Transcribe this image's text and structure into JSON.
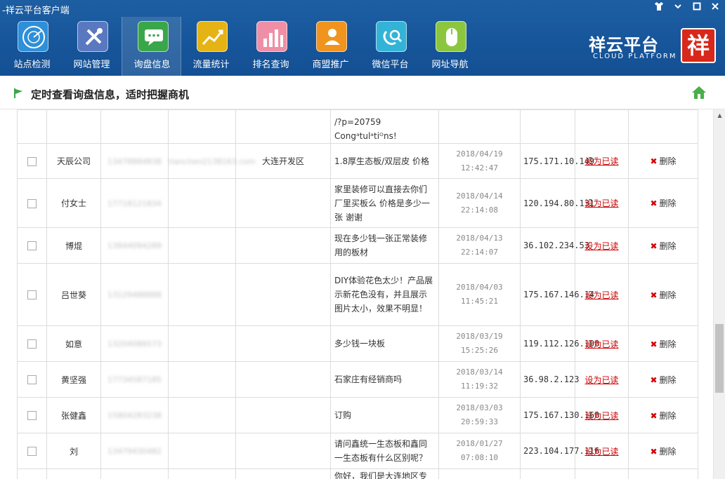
{
  "window": {
    "title": "-祥云平台客户端"
  },
  "nav": [
    {
      "label": "站点检测",
      "icon": "radar-icon",
      "color": "#2f8fd8"
    },
    {
      "label": "网站管理",
      "icon": "tools-icon",
      "color": "#5a78c0"
    },
    {
      "label": "询盘信息",
      "icon": "chat-icon",
      "color": "#3aa64a"
    },
    {
      "label": "流量统计",
      "icon": "trend-icon",
      "color": "#e6b314"
    },
    {
      "label": "排名查询",
      "icon": "bar-chart-icon",
      "color": "#ef8fa6"
    },
    {
      "label": "商盟推广",
      "icon": "people-icon",
      "color": "#f0941d"
    },
    {
      "label": "微信平台",
      "icon": "wechat-icon",
      "color": "#33b3d6"
    },
    {
      "label": "网址导航",
      "icon": "mouse-icon",
      "color": "#8cc63e"
    }
  ],
  "brand": {
    "cn": "祥云平台",
    "en": "CLOUD PLATFORM",
    "logo_char": "祥"
  },
  "subheader": {
    "title": "定时查看询盘信息，适时把握商机"
  },
  "table": {
    "mark_read_label": "设为已读",
    "delete_label": "删除",
    "rows": [
      {
        "name": "",
        "phone": "",
        "email": "",
        "region": "",
        "content": "/?p=20759 Congᵃtulᵃtiᴼns!",
        "time": "",
        "ip": "",
        "partial": true
      },
      {
        "name": "天辰公司",
        "phone": "13478884838",
        "email": "tianchen2138163.com",
        "region": "大连开发区",
        "content": "1.8厚生态板/双层皮 价格",
        "time": "2018/04/19 12:42:47",
        "ip": "175.171.10.149"
      },
      {
        "name": "付女士",
        "phone": "17718121834",
        "email": "",
        "region": "",
        "content": "家里装修可以直接去你们厂里买板么 价格是多少一张 谢谢",
        "time": "2018/04/14 22:14:08",
        "ip": "120.194.80.131"
      },
      {
        "name": "博焜",
        "phone": "13844094289",
        "email": "",
        "region": "",
        "content": "现在多少钱一张正常装修用的板材",
        "time": "2018/04/13 22:14:07",
        "ip": "36.102.234.53"
      },
      {
        "name": "吕世葵",
        "phone": "13129488888",
        "email": "",
        "region": "",
        "content": "DIY体验花色太少！产品展示新花色没有，并且展示图片太小，效果不明显！",
        "time": "2018/04/03 11:45:21",
        "ip": "175.167.146.14"
      },
      {
        "name": "如意",
        "phone": "13204086573",
        "email": "",
        "region": "",
        "content": "多少钱一块板",
        "time": "2018/03/19 15:25:26",
        "ip": "119.112.126.100"
      },
      {
        "name": "黄坚强",
        "phone": "17734587185",
        "email": "",
        "region": "",
        "content": "石家庄有经销商吗",
        "time": "2018/03/14 11:19:32",
        "ip": "36.98.2.123"
      },
      {
        "name": "张健鑫",
        "phone": "15804283238",
        "email": "",
        "region": "",
        "content": "订购",
        "time": "2018/03/03 20:59:33",
        "ip": "175.167.130.160"
      },
      {
        "name": "刘",
        "phone": "13479430482",
        "email": "",
        "region": "",
        "content": "请问鑫统一生态板和鑫同一生态板有什么区别呢？",
        "time": "2018/01/27 07:08:10",
        "ip": "223.104.177.116"
      },
      {
        "name": "",
        "phone": "",
        "email": "",
        "region": "",
        "content": "你好，我们是大连地区专",
        "time": "",
        "ip": "",
        "partial": true
      }
    ]
  }
}
